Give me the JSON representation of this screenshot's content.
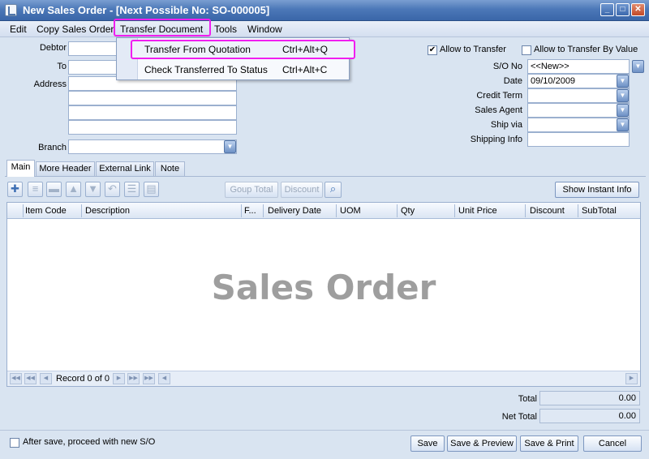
{
  "window": {
    "title": "New Sales Order - [Next Possible No: SO-000005]"
  },
  "menubar": {
    "items": [
      "Edit",
      "Copy Sales Order",
      "Transfer Document",
      "Tools",
      "Window"
    ]
  },
  "transfer_menu": {
    "items": [
      {
        "label": "Transfer From Quotation",
        "shortcut": "Ctrl+Alt+Q"
      },
      {
        "label": "Check Transferred To Status",
        "shortcut": "Ctrl+Alt+C"
      }
    ]
  },
  "left_form": {
    "debtor_label": "Debtor",
    "to_label": "To",
    "address_label": "Address",
    "branch_label": "Branch"
  },
  "right_form": {
    "allow_transfer_label": "Allow to Transfer",
    "allow_transfer_checked": true,
    "allow_transfer_value_label": "Allow to Transfer By Value",
    "allow_transfer_value_checked": false,
    "so_no_label": "S/O No",
    "so_no_value": "<<New>>",
    "date_label": "Date",
    "date_value": "09/10/2009",
    "credit_term_label": "Credit Term",
    "sales_agent_label": "Sales Agent",
    "ship_via_label": "Ship via",
    "shipping_info_label": "Shipping Info"
  },
  "tabs": [
    "Main",
    "More Header",
    "External Link",
    "Note"
  ],
  "toolbar": {
    "group_total_label": "Goup Total",
    "discount_label": "Discount",
    "show_instant_info_label": "Show Instant Info"
  },
  "grid": {
    "columns": [
      "Item Code",
      "Description",
      "F...",
      "Delivery Date",
      "UOM",
      "Qty",
      "Unit Price",
      "Discount",
      "SubTotal"
    ],
    "watermark": "Sales Order",
    "record_text": "Record 0 of 0"
  },
  "totals": {
    "total_label": "Total",
    "total_value": "0.00",
    "net_total_label": "Net Total",
    "net_total_value": "0.00"
  },
  "footer": {
    "after_save_label": "After save, proceed with new S/O",
    "after_save_checked": false,
    "save_label": "Save",
    "save_preview_label": "Save & Preview",
    "save_print_label": "Save & Print",
    "cancel_label": "Cancel"
  },
  "colors": {
    "highlight": "#f01ef0",
    "titlebar": "#4c78b8"
  }
}
